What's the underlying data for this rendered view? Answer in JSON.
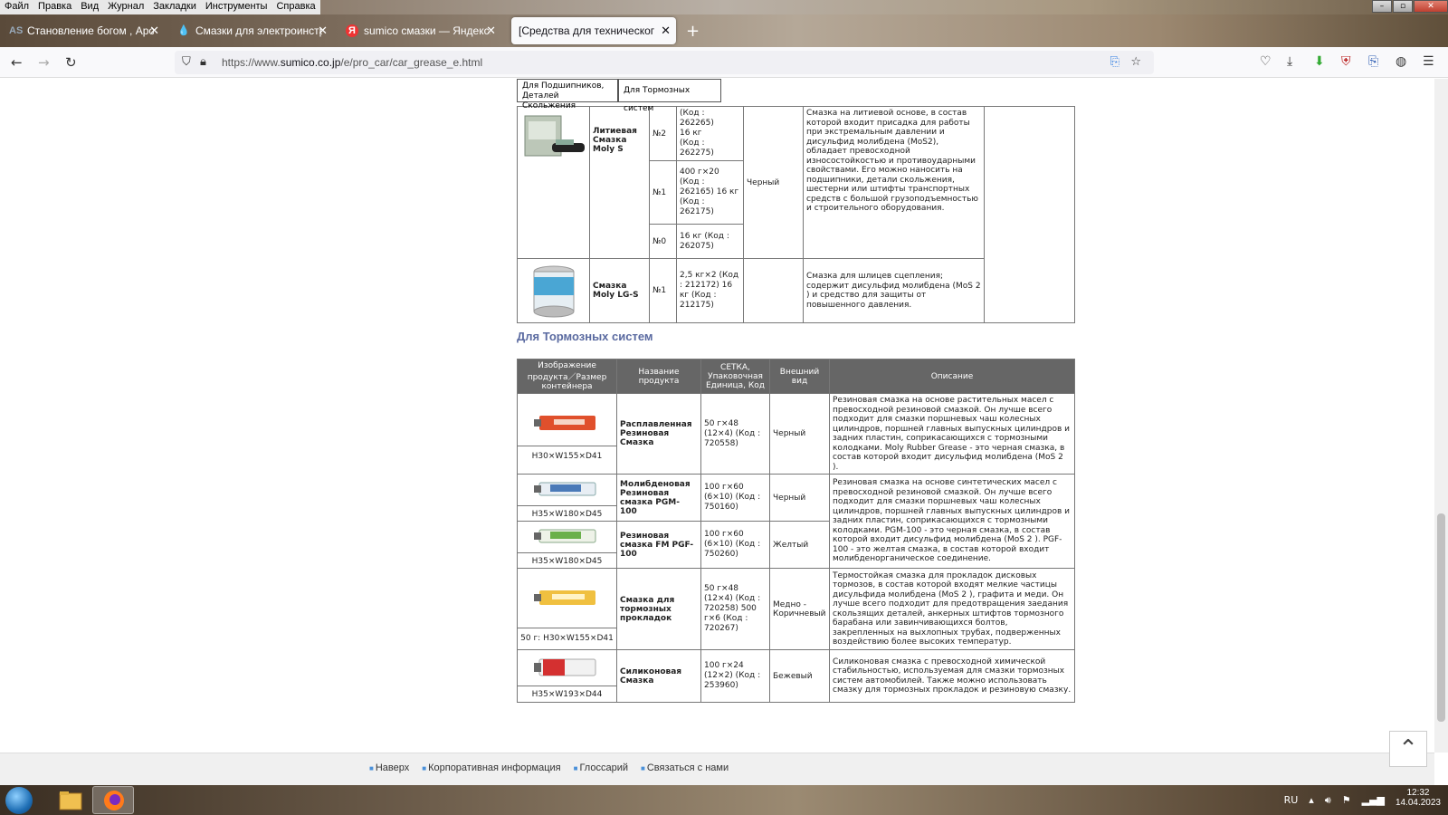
{
  "menu": [
    "Файл",
    "Правка",
    "Вид",
    "Журнал",
    "Закладки",
    "Инструменты",
    "Справка"
  ],
  "window_controls": {
    "minimize": "–",
    "maximize": "▫",
    "close": "✕"
  },
  "tabs": [
    {
      "label": "Становление богом , Apotheo",
      "icon": "AS"
    },
    {
      "label": "Смазки для электроинструме",
      "icon": "💧"
    },
    {
      "label": "sumico смазки — Яндекс: нашл",
      "icon": "Я"
    },
    {
      "label": "[Средства для технического обс",
      "icon": "["
    }
  ],
  "new_tab": "+",
  "url": {
    "prefix": "https://www.",
    "domain": "sumico.co.jp",
    "path": "/e/pro_car/car_grease_e.html"
  },
  "subnav": [
    "Для Подшипников, Деталей Скольжения",
    "Для Тормозных систем"
  ],
  "upper_table": {
    "partial_top": [
      "(Код :",
      "262265)",
      "16 кг",
      "(Код :",
      "262275)"
    ],
    "rows": [
      {
        "name": "Литиевая Смазка Moly S",
        "grade": "№2",
        "pack": "(Код : 262265) 16 кг (Код : 262275)"
      },
      {
        "grade": "№1",
        "pack": "400 г×20 (Код : 262165) 16 кг (Код : 262175)"
      },
      {
        "grade": "№0",
        "pack": "16 кг (Код : 262075)"
      },
      {
        "name": "Смазка Moly LG-S",
        "grade": "№1",
        "pack": "2,5 кг×2 (Код : 212172) 16 кг (Код : 212175)"
      }
    ],
    "color": "Черный",
    "desc1": "Смазка на литиевой основе, в состав которой входит присадка для работы при экстремальным давлении и дисульфид молибдена (MoS2), обладает превосходной износостойкостью и противоударными свойствами. Его можно наносить на подшипники, детали скольжения, шестерни или штифты транспортных средств с большой грузоподъемностью и строительного оборудования.",
    "desc2": "Смазка для шлицев сцепления; содержит дисульфид молибдена (MoS 2 ) и средство для защиты от повышенного давления."
  },
  "section_title": "Для Тормозных систем",
  "brake_table": {
    "headers": [
      "Изображение продукта／Размер контейнера",
      "Название продукта",
      "СЕТКА, Упаковочная Единица, Код",
      "Внешний вид",
      "Описание"
    ],
    "rows": [
      {
        "size": "H30×W155×D41",
        "name": "Расплавленная Резиновая Смазка",
        "pack": "50 г×48 (12×4) (Код : 720558)",
        "color": "Черный",
        "desc": "Резиновая смазка на основе растительных масел с превосходной резиновой смазкой. Он лучше всего подходит для смазки поршневых чаш колесных цилиндров, поршней главных выпускных цилиндров и задних пластин, соприкасающихся с тормозными колодками. Moly Rubber Grease - это черная смазка, в состав которой входит дисульфид молибдена (MoS 2 )."
      },
      {
        "size": "H35×W180×D45",
        "name": "Молибденовая Резиновая смазка PGM- 100",
        "pack": "100 г×60 (6×10) (Код : 750160)",
        "color": "Черный",
        "desc": "Резиновая смазка на основе синтетических масел с превосходной резиновой смазкой. Он лучше всего подходит для смазки поршневых чаш колесных цилиндров, поршней главных выпускных цилиндров и задних пластин, соприкасающихся с тормозными колодками. PGM-100 - это черная смазка, в состав которой входит дисульфид молибдена (MoS 2 ). PGF-100 - это желтая смазка, в состав которой входит молибденорганическое соединение."
      },
      {
        "size": "H35×W180×D45",
        "name": "Резиновая смазка FM PGF-100",
        "pack": "100 г×60 (6×10) (Код : 750260)",
        "color": "Желтый"
      },
      {
        "size": "50 г: H30×W155×D41",
        "name": "Смазка для тормозных прокладок",
        "pack": "50 г×48 (12×4) (Код : 720258) 500 г×6 (Код : 720267)",
        "color": "Медно - Коричневый",
        "desc": "Термостойкая смазка для прокладок дисковых тормозов, в состав которой входят мелкие частицы дисульфида молибдена (MoS 2 ), графита и меди. Он лучше всего подходит для предотвращения заедания скользящих деталей, анкерных штифтов тормозного барабана или завинчивающихся болтов, закрепленных на выхлопных трубах, подверженных воздействию более высоких температур."
      },
      {
        "size": "H35×W193×D44",
        "name": "Силиконовая Смазка",
        "pack": "100 г×24 (12×2) (Код : 253960)",
        "color": "Бежевый",
        "desc": "Силиконовая смазка с превосходной химической стабильностью, используемая для смазки тормозных систем автомобилей. Также можно использовать смазку для тормозных прокладок и резиновую смазку."
      }
    ]
  },
  "footer_links": [
    "Наверх",
    "Корпоративная информация",
    "Глоссарий",
    "Связаться с нами"
  ],
  "to_top": "⌃",
  "tray": {
    "lang": "RU",
    "time": "12:32",
    "date": "14.04.2023"
  },
  "colors": {
    "header_bg": "#666666",
    "section_title": "#5a6aa0",
    "accent": "#4a90d9"
  }
}
